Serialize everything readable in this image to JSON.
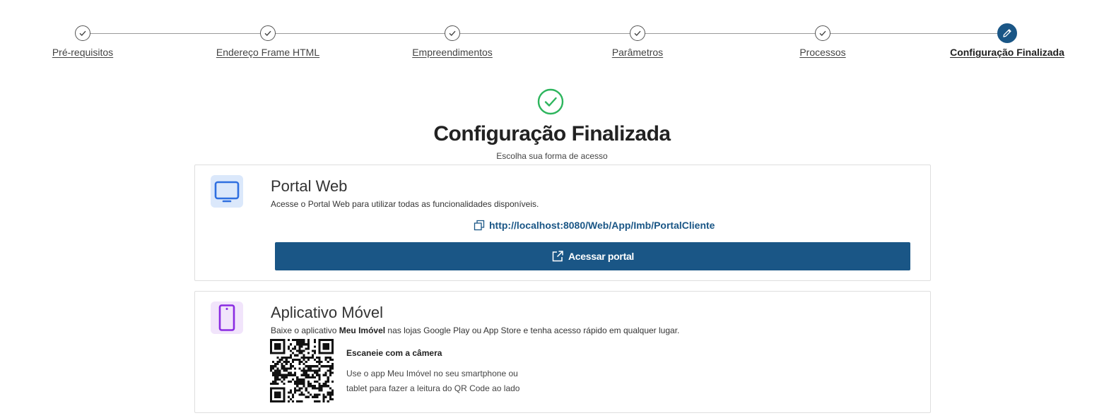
{
  "stepper": {
    "steps": [
      {
        "label": "Pré-requisitos",
        "state": "done",
        "icon": "check-icon"
      },
      {
        "label": "Endereço Frame HTML",
        "state": "done",
        "icon": "check-icon"
      },
      {
        "label": "Empreendimentos",
        "state": "done",
        "icon": "check-icon"
      },
      {
        "label": "Parâmetros",
        "state": "done",
        "icon": "check-icon"
      },
      {
        "label": "Processos",
        "state": "done",
        "icon": "check-icon"
      },
      {
        "label": "Configuração Finalizada",
        "state": "active",
        "icon": "pencil-icon"
      }
    ]
  },
  "header": {
    "icon": "check-circle-icon",
    "title": "Configuração Finalizada",
    "subtitle": "Escolha sua forma de acesso"
  },
  "portal": {
    "icon": "monitor-icon",
    "title": "Portal Web",
    "description": "Acesse o Portal Web para utilizar todas as funcionalidades disponíveis.",
    "url": "http://localhost:8080/Web/App/Imb/PortalCliente",
    "copy_icon": "copy-icon",
    "button_label": "Acessar portal",
    "button_icon": "external-link-icon"
  },
  "app": {
    "icon": "smartphone-icon",
    "title": "Aplicativo Móvel",
    "description_before": "Baixe o aplicativo ",
    "description_app_name": "Meu Imóvel",
    "description_after": " nas lojas Google Play ou App Store e tenha acesso rápido em qualquer lugar.",
    "qr_icon": "qr-code",
    "qr_title": "Escaneie com a câmera",
    "qr_line1": "Use o app Meu Imóvel no seu smartphone ou",
    "qr_line2": "tablet para fazer a leitura do QR Code ao lado"
  },
  "colors": {
    "primary": "#1a5686",
    "success": "#2db55d",
    "web_icon": "#2f6fe0",
    "app_icon": "#8a2be2"
  }
}
